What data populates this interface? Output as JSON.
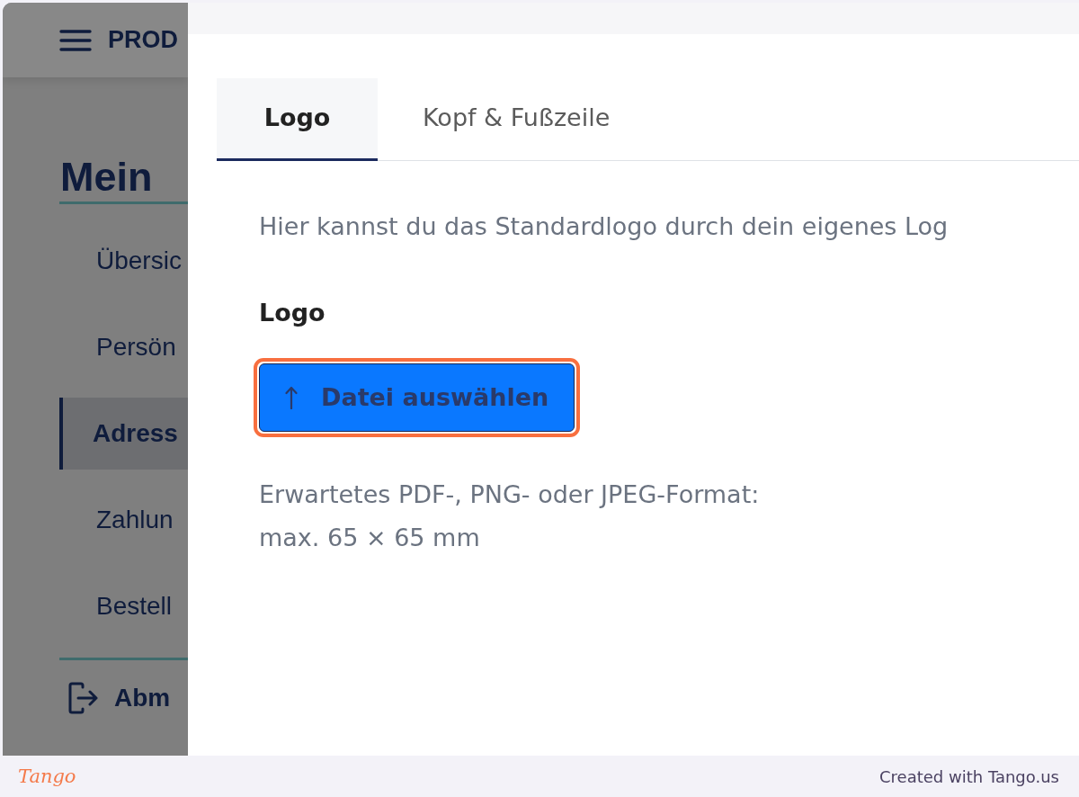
{
  "background_page": {
    "header": {
      "brand": "PROD"
    },
    "heading": "Mein",
    "nav": [
      {
        "label": "Übersic",
        "selected": false
      },
      {
        "label": "Persön",
        "selected": false
      },
      {
        "label": "Adress",
        "selected": true
      },
      {
        "label": "Zahlun",
        "selected": false
      },
      {
        "label": "Bestell",
        "selected": false
      }
    ],
    "logout": {
      "label": "Abm"
    }
  },
  "panel": {
    "tabs": [
      {
        "label": "Logo",
        "selected": true
      },
      {
        "label": "Kopf & Fußzeile",
        "selected": false
      }
    ],
    "description": "Hier kannst du das Standardlogo durch dein eigenes Log",
    "field_label": "Logo",
    "upload_button": {
      "label": "Datei auswählen",
      "highlighted": true
    },
    "hint_lines": [
      "Erwartetes PDF-, PNG- oder JPEG-Format:",
      "max. 65 × 65 mm"
    ]
  },
  "footer": {
    "brand": "Tango",
    "credit": "Created with Tango.us"
  }
}
